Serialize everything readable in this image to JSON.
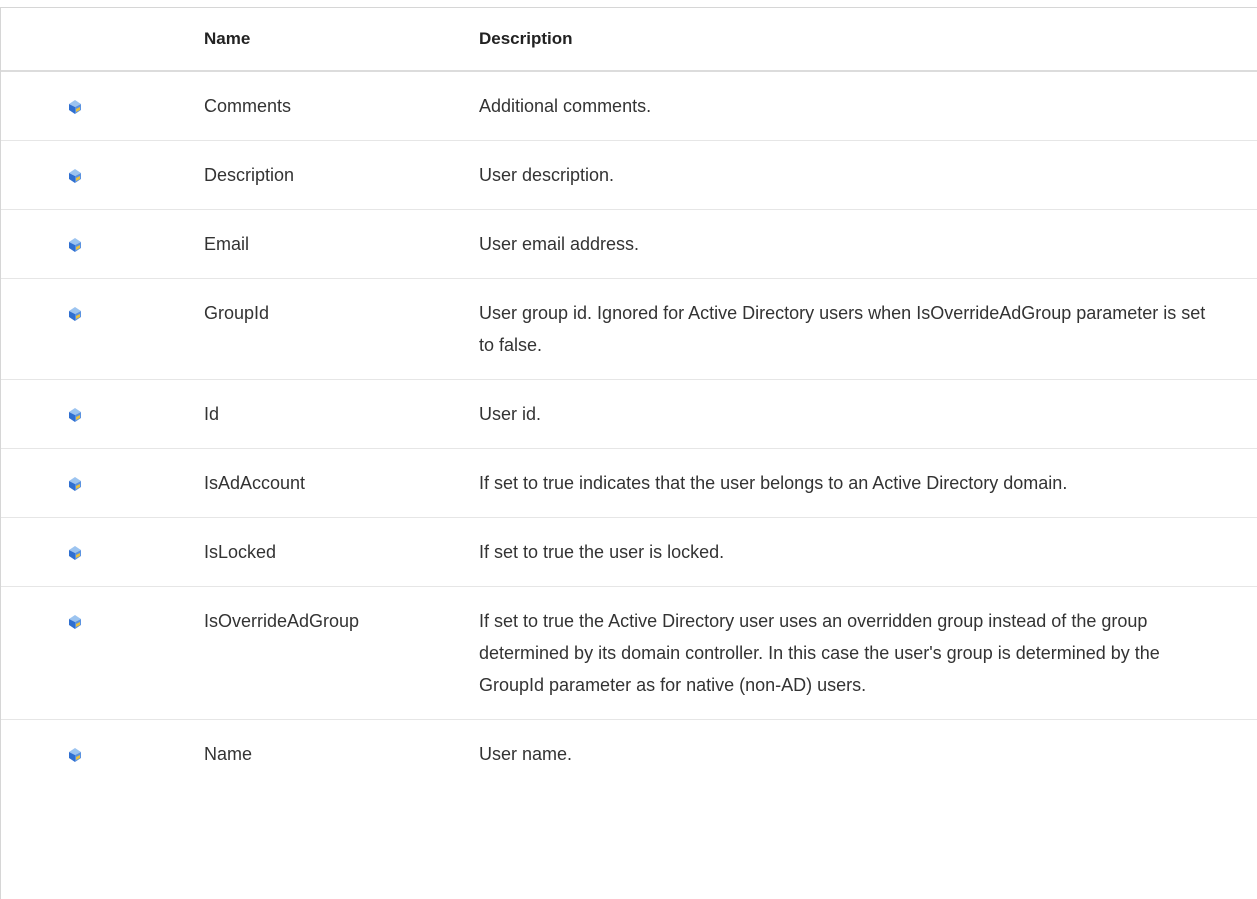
{
  "table": {
    "headers": {
      "icon": "",
      "name": "Name",
      "description": "Description"
    },
    "rows": [
      {
        "icon": "property-icon",
        "name": "Comments",
        "description": "Additional comments."
      },
      {
        "icon": "property-icon",
        "name": "Description",
        "description": "User description."
      },
      {
        "icon": "property-icon",
        "name": "Email",
        "description": "User email address."
      },
      {
        "icon": "property-icon",
        "name": "GroupId",
        "description": "User group id. Ignored for Active Directory users when IsOverrideAdGroup parameter is set to false."
      },
      {
        "icon": "property-icon",
        "name": "Id",
        "description": "User id."
      },
      {
        "icon": "property-icon",
        "name": "IsAdAccount",
        "description": "If set to true indicates that the user belongs to an Active Directory domain."
      },
      {
        "icon": "property-icon",
        "name": "IsLocked",
        "description": "If set to true the user is locked."
      },
      {
        "icon": "property-icon",
        "name": "IsOverrideAdGroup",
        "description": "If set to true the Active Directory user uses an overridden group instead of the group determined by its domain controller. In this case the user's group is determined by the GroupId parameter as for native (non-AD) users."
      },
      {
        "icon": "property-icon",
        "name": "Name",
        "description": "User name."
      }
    ]
  },
  "colors": {
    "icon_light": "#9cc4f0",
    "icon_dark": "#2f6fd0",
    "icon_accent": "#e8c040"
  }
}
